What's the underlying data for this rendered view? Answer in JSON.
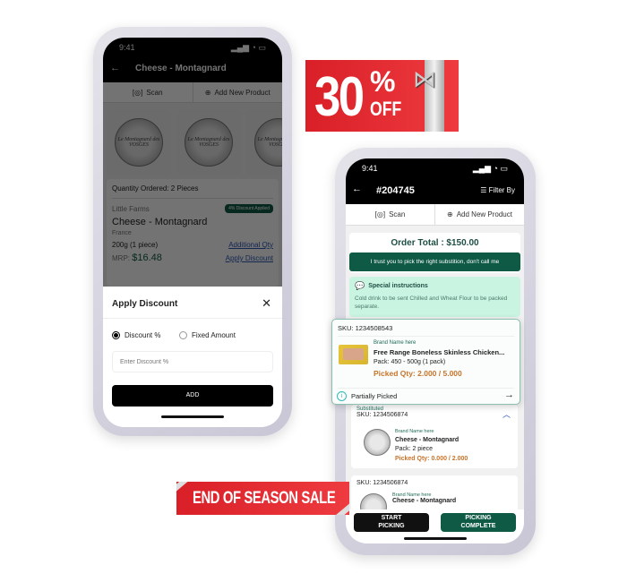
{
  "left_phone": {
    "time": "9:41",
    "title": "Cheese - Montagnard",
    "scan_label": "Scan",
    "add_product_label": "Add New Product",
    "cheese_label": "Le Montagnard des VOSGES",
    "quantity_ordered": "Quantity Ordered: 2 Pieces",
    "brand": "Little Farms",
    "discount_badge": "4% Discount Applied",
    "product_name": "Cheese - Montagnard",
    "origin": "France",
    "weight": "200g (1 piece)",
    "additional_qty_link": "Additional Qty",
    "mrp_label": "MRP:",
    "mrp_value": "$16.48",
    "apply_discount_link": "Apply Discount",
    "modal": {
      "title": "Apply Discount",
      "option_percent": "Discount %",
      "option_fixed": "Fixed Amount",
      "selected": "Discount %",
      "input_placeholder": "Enter Discount %",
      "add_button": "ADD"
    }
  },
  "right_phone": {
    "time": "9:41",
    "order_id": "#204745",
    "filter_label": "Filter By",
    "scan_label": "Scan",
    "add_product_label": "Add New Product",
    "order_total": "Order Total : $150.00",
    "customer_note": "I trust you to pick the right substition, don't call me",
    "special_title": "Special instructions",
    "special_text": "Cold drink to be sent Chilled and Wheat Flour to be packed separate.",
    "popup_item": {
      "sku": "SKU: 1234508543",
      "brand": "Brand Name here",
      "name": "Free Range Boneless Skinless Chicken...",
      "pack": "Pack: 450 - 500g (1 pack)",
      "picked": "Picked Qty: 2.000 / 5.000",
      "status": "Partially Picked"
    },
    "substituted_item": {
      "tag": "Substituted",
      "sku": "SKU: 1234506874",
      "brand": "Brand Name here",
      "name": "Cheese - Montagnard",
      "pack": "Pack: 2 piece",
      "picked": "Picked Qty: 0.000 / 2.000"
    },
    "next_item": {
      "sku": "SKU: 1234506874",
      "brand": "Brand Name here",
      "name": "Cheese - Montagnard"
    },
    "start_button": "START PICKING",
    "complete_button": "PICKING COMPLETE"
  },
  "banners": {
    "discount_main": "30",
    "discount_percent": "%",
    "discount_off": "OFF",
    "sale": "END OF SEASON SALE"
  },
  "colors": {
    "accent_green": "#0e5a45",
    "banner_red": "#e3282f",
    "picked_orange": "#c8742a",
    "special_bg": "#c9f4e2"
  }
}
